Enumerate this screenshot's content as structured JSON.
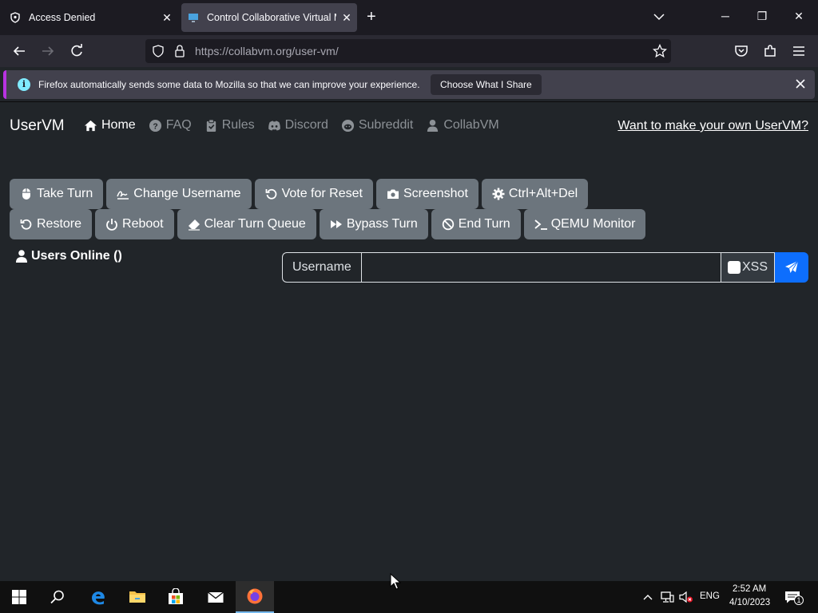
{
  "browser": {
    "tabs": [
      {
        "title": "Access Denied",
        "active": false
      },
      {
        "title": "Control Collaborative Virtual M",
        "active": true
      }
    ],
    "url_host": "https://collabvm.org",
    "url_path": "/user-vm/",
    "notification": {
      "text": "Firefox automatically sends some data to Mozilla so that we can improve your experience.",
      "button": "Choose What I Share"
    }
  },
  "page": {
    "brand": "UserVM",
    "nav": [
      {
        "label": "Home",
        "icon": "home-icon",
        "active": true
      },
      {
        "label": "FAQ",
        "icon": "question-icon",
        "active": false
      },
      {
        "label": "Rules",
        "icon": "clipboard-check-icon",
        "active": false
      },
      {
        "label": "Discord",
        "icon": "discord-icon",
        "active": false
      },
      {
        "label": "Subreddit",
        "icon": "reddit-icon",
        "active": false
      },
      {
        "label": "CollabVM",
        "icon": "user-icon",
        "active": false
      }
    ],
    "cta": "Want to make your own UserVM?",
    "buttons_row1": [
      {
        "label": "Take Turn",
        "icon": "mouse-icon"
      },
      {
        "label": "Change Username",
        "icon": "signature-icon"
      },
      {
        "label": "Vote for Reset",
        "icon": "rotate-left-icon"
      },
      {
        "label": "Screenshot",
        "icon": "camera-icon"
      },
      {
        "label": "Ctrl+Alt+Del",
        "icon": "gear-icon"
      }
    ],
    "buttons_row2": [
      {
        "label": "Restore",
        "icon": "rotate-left-icon"
      },
      {
        "label": "Reboot",
        "icon": "power-icon"
      },
      {
        "label": "Clear Turn Queue",
        "icon": "eraser-icon"
      },
      {
        "label": "Bypass Turn",
        "icon": "forward-icon"
      },
      {
        "label": "End Turn",
        "icon": "ban-icon"
      },
      {
        "label": "QEMU Monitor",
        "icon": "terminal-icon"
      }
    ],
    "users_online": "Users Online ()",
    "chat": {
      "label": "Username",
      "value": "",
      "xss_label": "XSS"
    }
  },
  "taskbar": {
    "time": "2:52 AM",
    "date": "4/10/2023",
    "language": "ENG",
    "notification_count": "1"
  },
  "colors": {
    "page_bg": "#212529",
    "button_bg": "#6c757d",
    "send_button": "#0d6efd",
    "notification_accent": "#b833e1"
  }
}
